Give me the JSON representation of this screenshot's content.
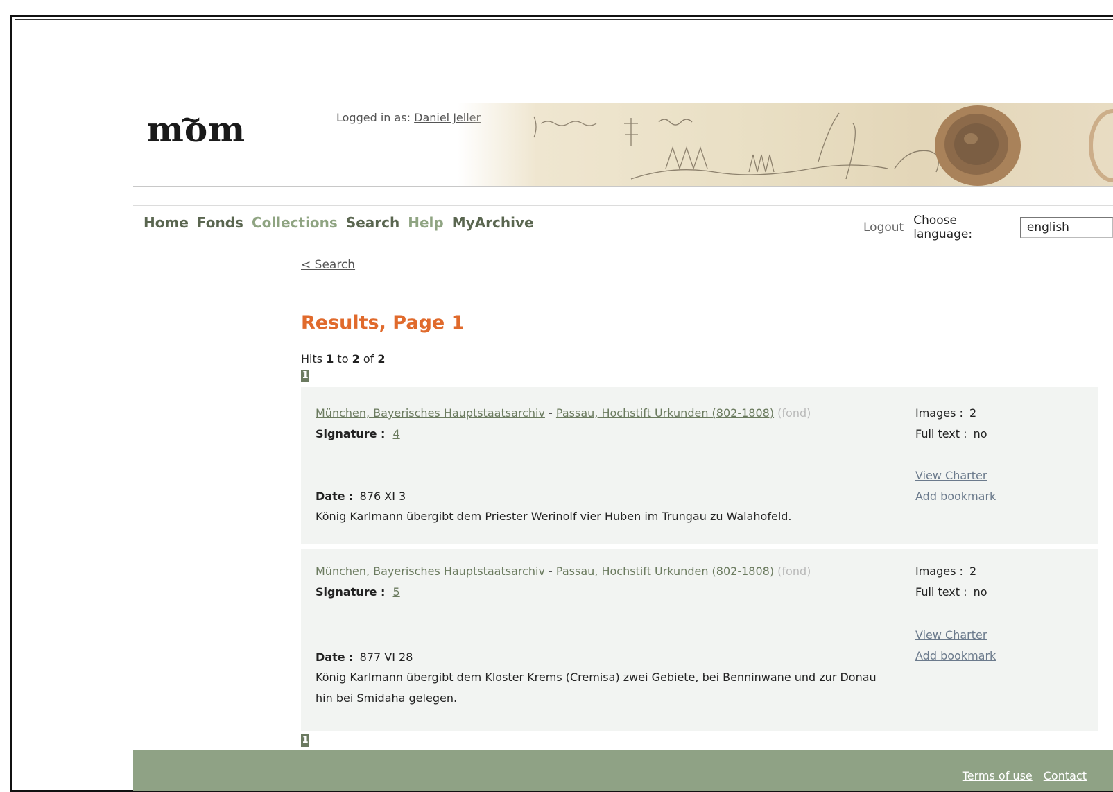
{
  "header": {
    "logo_text": "mom",
    "logged_in_label": "Logged in as:",
    "user_name": "Daniel Jeller"
  },
  "nav": {
    "items": [
      {
        "label": "Home"
      },
      {
        "label": "Fonds"
      },
      {
        "label": "Collections"
      },
      {
        "label": "Search"
      },
      {
        "label": "Help"
      },
      {
        "label": "MyArchive"
      }
    ],
    "logout": "Logout",
    "choose_language_label": "Choose language:",
    "language_value": "english"
  },
  "main": {
    "back_link": "< Search",
    "title": "Results, Page 1",
    "hits": {
      "prefix": "Hits",
      "from": "1",
      "to_label": "to",
      "to": "2",
      "of_label": "of",
      "total": "2"
    },
    "page_number": "1",
    "results": [
      {
        "archive": "München, Bayerisches Hauptstaatsarchiv",
        "separator": "-",
        "fond": "Passau, Hochstift Urkunden (802-1808)",
        "fond_type": "(fond)",
        "signature_label": "Signature :",
        "signature": "4",
        "date_label": "Date :",
        "date": "876 XI 3",
        "description": "König Karlmann übergibt dem Priester Werinolf vier Huben im Trungau zu Walahofeld.",
        "images_label": "Images :",
        "images": "2",
        "fulltext_label": "Full text :",
        "fulltext": "no",
        "view_charter": "View Charter",
        "add_bookmark": "Add bookmark"
      },
      {
        "archive": "München, Bayerisches Hauptstaatsarchiv",
        "separator": "-",
        "fond": "Passau, Hochstift Urkunden (802-1808)",
        "fond_type": "(fond)",
        "signature_label": "Signature :",
        "signature": "5",
        "date_label": "Date :",
        "date": "877 VI 28",
        "description": "König Karlmann übergibt dem Kloster Krems (Cremisa) zwei Gebiete, bei Benninwane und zur Donau hin bei Smidaha gelegen.",
        "images_label": "Images :",
        "images": "2",
        "fulltext_label": "Full text :",
        "fulltext": "no",
        "view_charter": "View Charter",
        "add_bookmark": "Add bookmark"
      }
    ]
  },
  "footer": {
    "terms": "Terms of use",
    "contact": "Contact"
  },
  "colors": {
    "accent_title": "#e06a2c",
    "nav_dark": "#5a6650",
    "nav_light": "#8fa482",
    "footer_bg": "#8fa285",
    "card_bg": "#f2f4f2"
  }
}
